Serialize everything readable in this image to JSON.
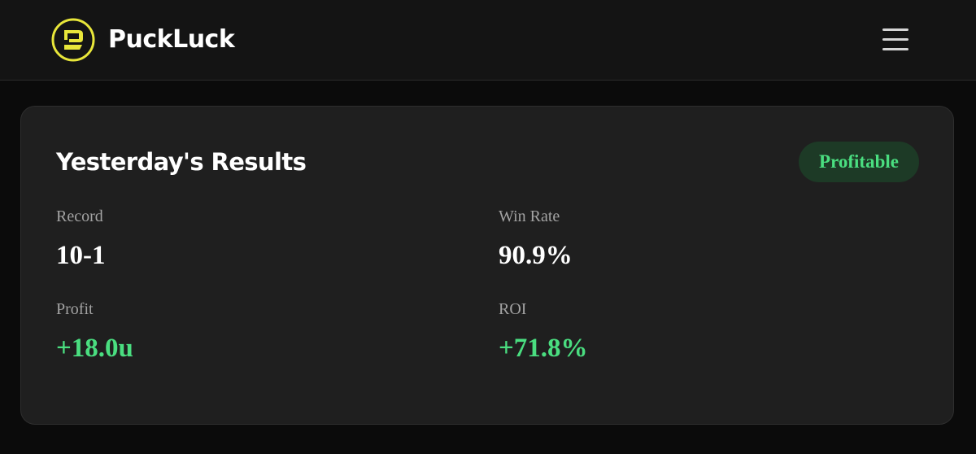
{
  "header": {
    "brand_name": "PuckLuck",
    "logo_icon": "puckluck-logo-icon",
    "menu_icon": "hamburger-menu-icon"
  },
  "results": {
    "title": "Yesterday's Results",
    "status": "Profitable",
    "stats": {
      "record": {
        "label": "Record",
        "value": "10-1"
      },
      "win_rate": {
        "label": "Win Rate",
        "value": "90.9%"
      },
      "profit": {
        "label": "Profit",
        "value": "+18.0u"
      },
      "roi": {
        "label": "ROI",
        "value": "+71.8%"
      }
    }
  },
  "colors": {
    "page_background": "#0b0b0b",
    "header_background": "#141414",
    "card_background": "#1f1f1f",
    "brand_accent": "#e8e63a",
    "positive": "#4ade80",
    "badge_background": "#1d3a26",
    "label_text": "#a3a3a3",
    "primary_text": "#ffffff"
  }
}
